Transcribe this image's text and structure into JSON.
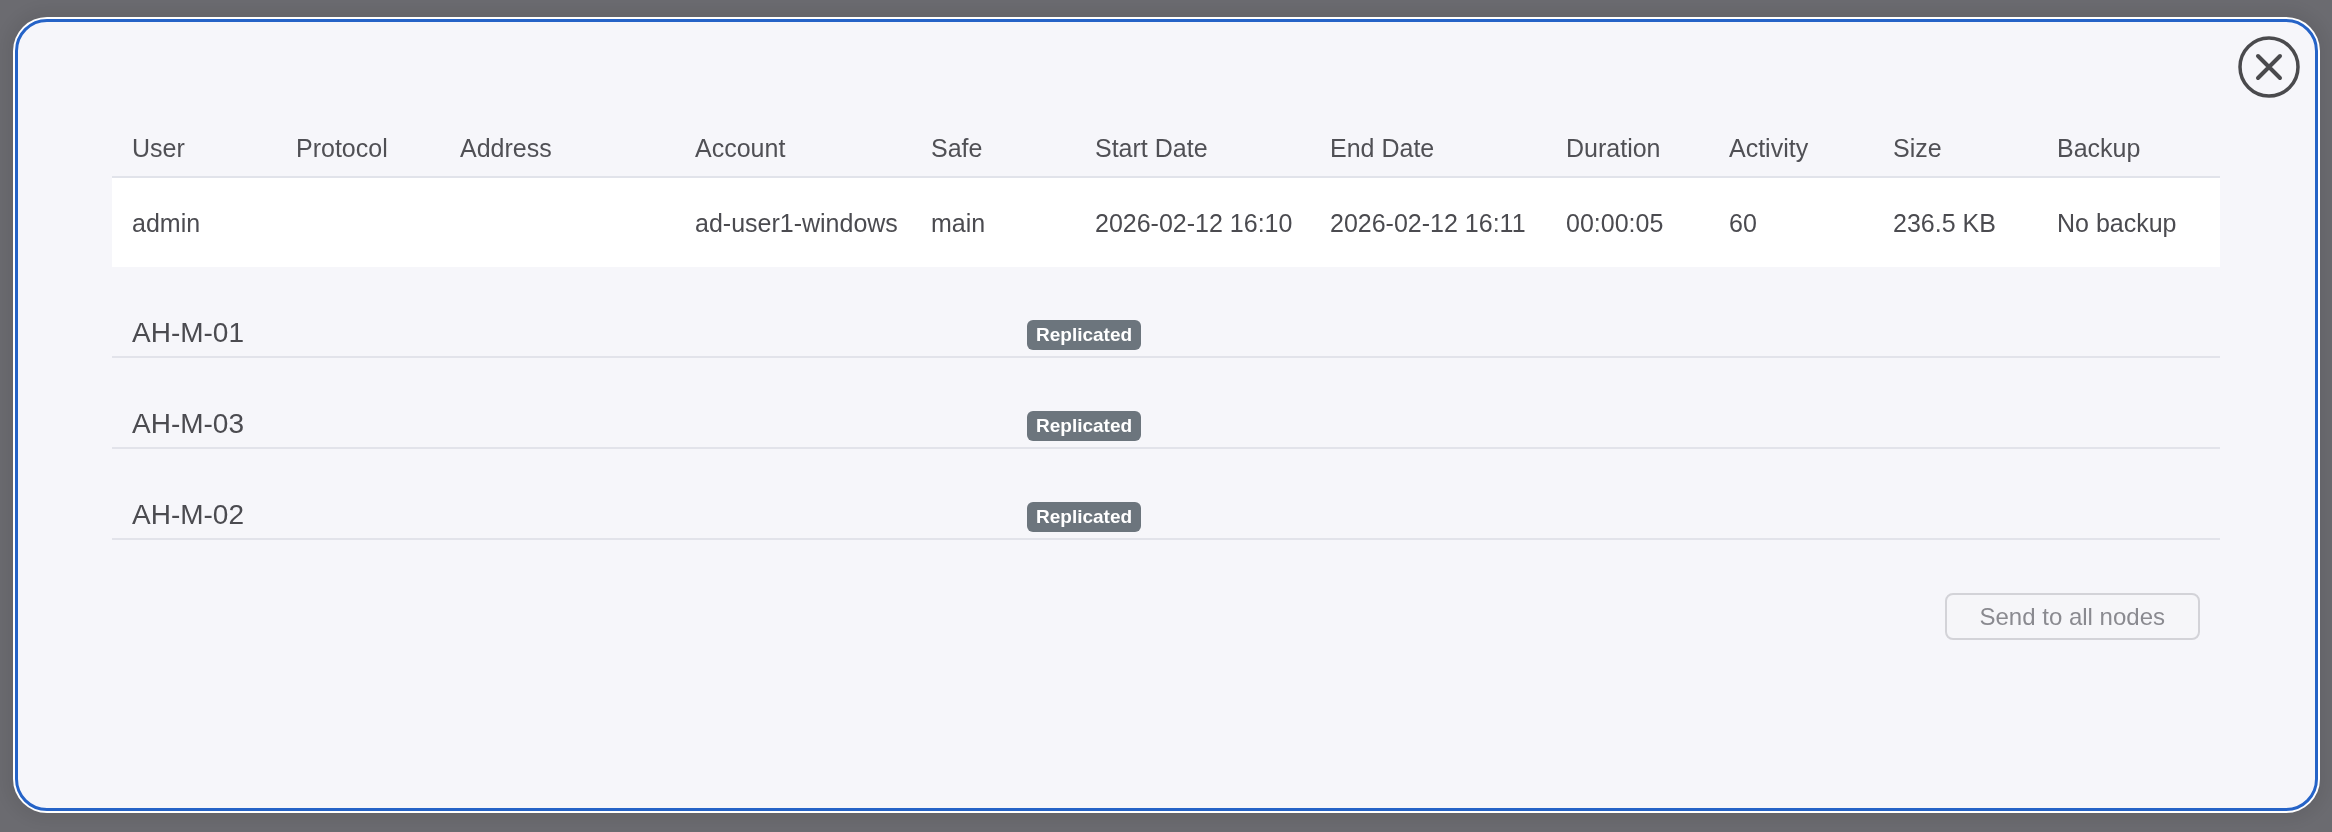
{
  "table": {
    "columns": [
      "User",
      "Protocol",
      "Address",
      "Account",
      "Safe",
      "Start Date",
      "End Date",
      "Duration",
      "Activity",
      "Size",
      "Backup"
    ],
    "rows": [
      {
        "user": "admin",
        "account": "ad-user1-windows",
        "safe": "main",
        "start_date": "2026-02-12 16:10",
        "end_date": "2026-02-12 16:11",
        "duration": "00:00:05",
        "activity": "60",
        "size": "236.5 KB",
        "backup": "No backup"
      }
    ]
  },
  "nodes": [
    {
      "name": "AH-M-01",
      "status": "Replicated"
    },
    {
      "name": "AH-M-03",
      "status": "Replicated"
    },
    {
      "name": "AH-M-02",
      "status": "Replicated"
    }
  ],
  "send_button": {
    "label": "Send to all nodes",
    "disabled": true
  }
}
